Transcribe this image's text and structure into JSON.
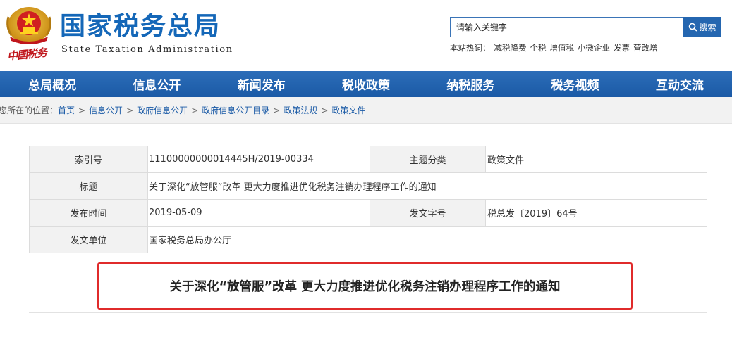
{
  "header": {
    "logo_calligraphy": "中国税务",
    "site_name_cn": "国家税务总局",
    "site_name_en": "State Taxation Administration",
    "colors": {
      "brand_blue": "#1467b8",
      "seal_red": "#c0161c"
    }
  },
  "search": {
    "placeholder": "请输入关键字",
    "button_label": "搜索",
    "icon": "search-icon"
  },
  "hotwords": {
    "label": "本站热词：",
    "items": [
      "减税降费",
      "个税",
      "增值税",
      "小微企业",
      "发票",
      "营改增"
    ]
  },
  "nav": {
    "items": [
      "总局概况",
      "信息公开",
      "新闻发布",
      "税收政策",
      "纳税服务",
      "税务视频",
      "互动交流"
    ],
    "color": "#1f60aa"
  },
  "breadcrumb": {
    "prefix": "您所在的位置：",
    "items": [
      "首页",
      "信息公开",
      "政府信息公开",
      "政府信息公开目录",
      "政策法规",
      "政策文件"
    ],
    "separator": ">"
  },
  "meta": {
    "index_label": "索引号",
    "index_value": "11100000000014445H/2019-00334",
    "topic_label": "主题分类",
    "topic_value": "政策文件",
    "title_label": "标题",
    "title_value": "关于深化“放管服”改革 更大力度推进优化税务注销办理程序工作的通知",
    "date_label": "发布时间",
    "date_value": "2019-05-09",
    "docno_label": "发文字号",
    "docno_value": "税总发〔2019〕64号",
    "issuer_label": "发文单位",
    "issuer_value": "国家税务总局办公厅"
  },
  "article": {
    "title": "关于深化“放管服”改革 更大力度推进优化税务注销办理程序工作的通知",
    "highlight_color": "#e02b2b"
  }
}
